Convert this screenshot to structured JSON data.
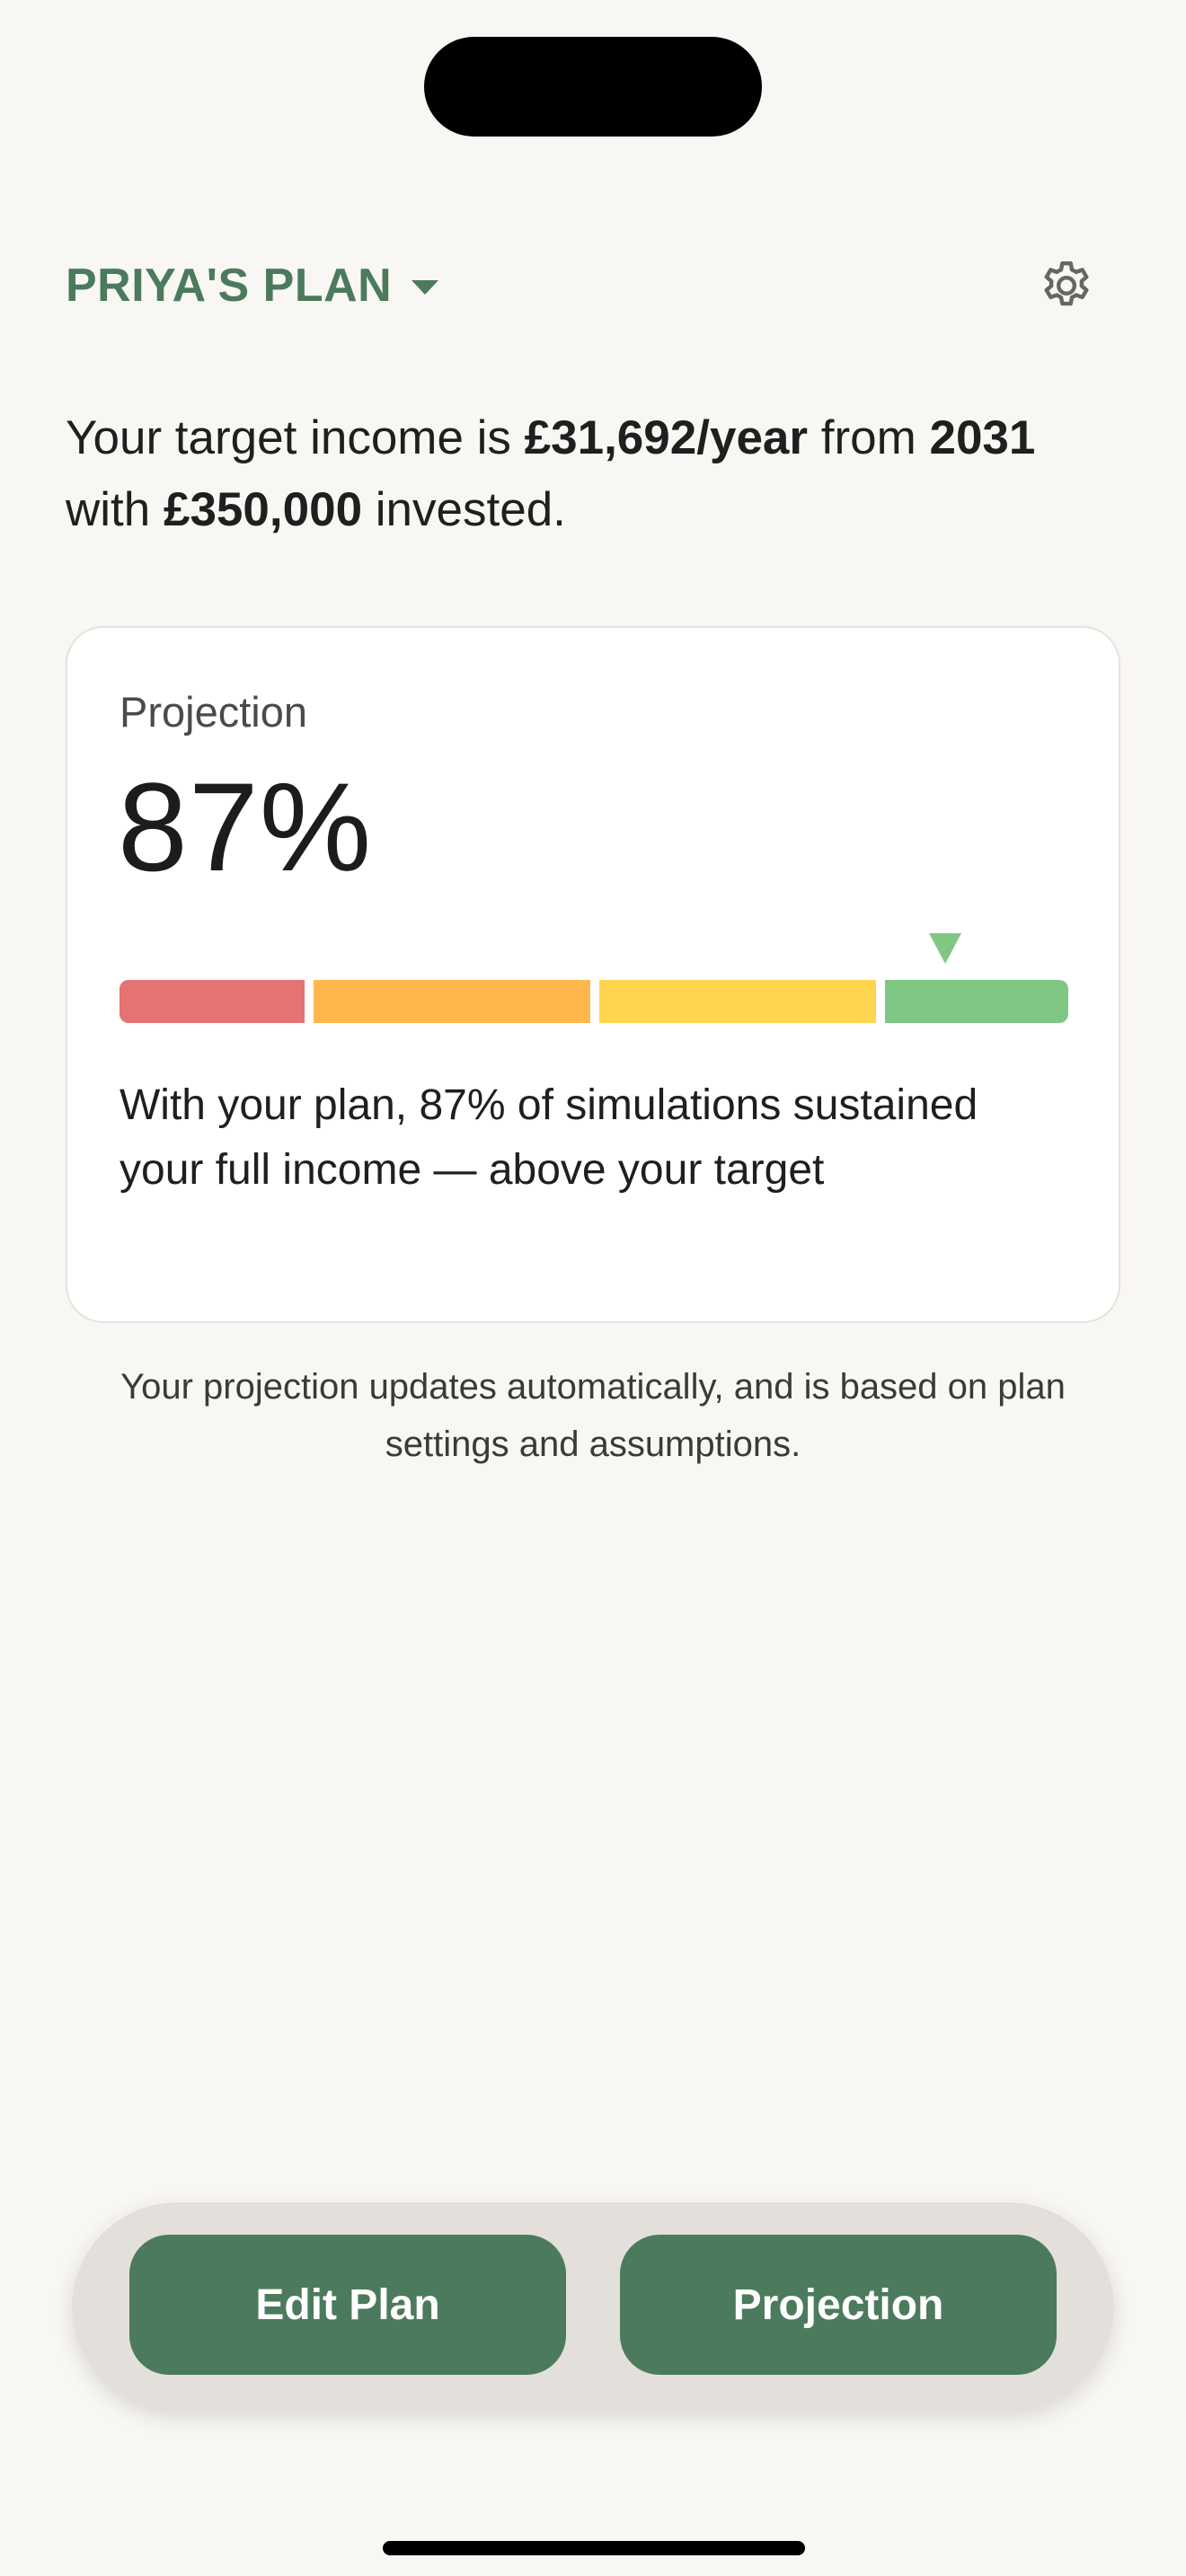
{
  "header": {
    "plan_name": "PRIYA'S PLAN",
    "plan_dropdown_icon": "caret-down-icon",
    "settings_icon": "gear-icon"
  },
  "intro": {
    "text_1": "Your target income is ",
    "income": "£31,692/year",
    "text_2": " from ",
    "year": "2031",
    "text_3": "with ",
    "invested": "£350,000",
    "text_4": " invested."
  },
  "projection_card": {
    "label": "Projection",
    "value": "87%",
    "success_fraction": 0.87,
    "gauge_bands": [
      {
        "name": "red",
        "color": "#e57373"
      },
      {
        "name": "orange",
        "color": "#ffb74d"
      },
      {
        "name": "yellow",
        "color": "#ffd54f"
      },
      {
        "name": "green",
        "color": "#81c784"
      }
    ],
    "description": "With your plan, 87% of simulations sustained your full income — above your target"
  },
  "footnote": "Your projection updates automatically, and is based on plan settings and assumptions.",
  "tabbar": {
    "edit_label": "Edit Plan",
    "projection_label": "Projection"
  },
  "colors": {
    "accent": "#4c7a5c",
    "background": "#f9f7f3",
    "card": "#ffffff"
  }
}
